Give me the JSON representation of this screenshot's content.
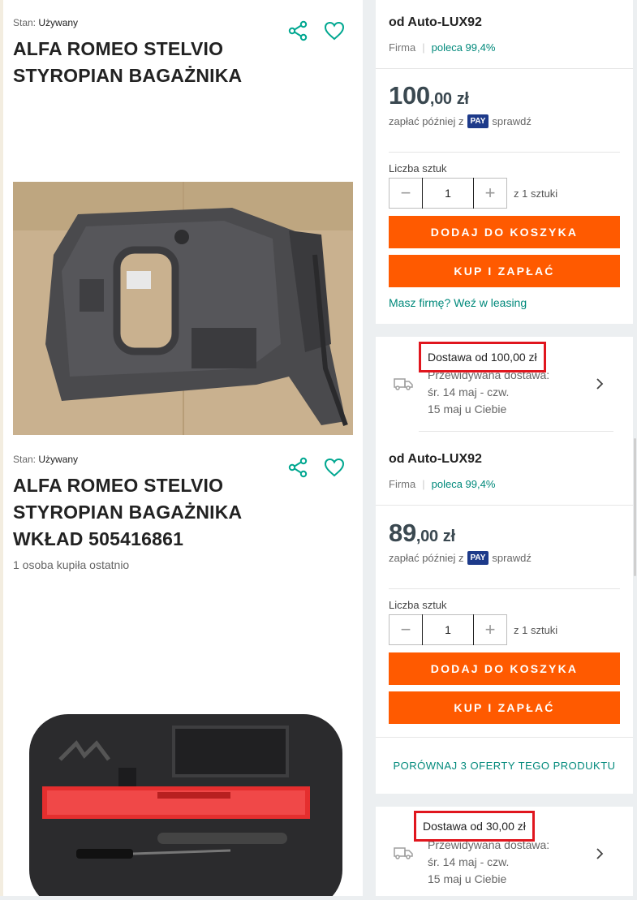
{
  "offers": [
    {
      "condition_label": "Stan:",
      "condition_value": "Używany",
      "title_lines": [
        "ALFA ROMEO STELVIO",
        "STYROPIAN BAGAŻNIKA"
      ],
      "image_alt": "Szara wkładka styropianowa bagażnika",
      "seller": {
        "name": "od Auto-LUX92",
        "type": "Firma",
        "recommend": "poleca 99,4%"
      },
      "price": {
        "whole": "100",
        "decimal": ",00",
        "currency": "zł"
      },
      "pay_later": {
        "prefix": "zapłać później z",
        "badge": "PAY",
        "suffix": "sprawdź"
      },
      "quantity": {
        "label": "Liczba sztuk",
        "value": "1",
        "of": "z 1 sztuki"
      },
      "add_to_cart": "DODAJ DO KOSZYKA",
      "buy_now": "KUP I ZAPŁAĆ",
      "leasing_link": "Masz firmę? Weź w leasing",
      "delivery": {
        "from": "Dostawa od 100,00 zł",
        "lines": [
          "Przewidywana dostawa:",
          "śr. 14 maj - czw.",
          "15 maj u Ciebie"
        ]
      }
    },
    {
      "condition_label": "Stan:",
      "condition_value": "Używany",
      "title_lines": [
        "ALFA ROMEO STELVIO",
        "STYROPIAN BAGAŻNIKA",
        "WKŁAD 505416861"
      ],
      "sold_info": "1 osoba kupiła ostatnio",
      "image_alt": "Czarna wkładka piankowa z trójkątem ostrzegawczym",
      "seller": {
        "name": "od Auto-LUX92",
        "type": "Firma",
        "recommend": "poleca 99,4%"
      },
      "price": {
        "whole": "89",
        "decimal": ",00",
        "currency": "zł"
      },
      "pay_later": {
        "prefix": "zapłać później z",
        "badge": "PAY",
        "suffix": "sprawdź"
      },
      "quantity": {
        "label": "Liczba sztuk",
        "value": "1",
        "of": "z 1 sztuki"
      },
      "add_to_cart": "DODAJ DO KOSZYKA",
      "buy_now": "KUP I ZAPŁAĆ",
      "compare_link": "PORÓWNAJ 3 OFERTY TEGO PRODUKTU",
      "delivery": {
        "from": "Dostawa od 30,00 zł",
        "lines": [
          "Przewidywana dostawa:",
          "śr. 14 maj - czw.",
          "15 maj u Ciebie"
        ]
      }
    }
  ],
  "icons": [
    "share-icon",
    "heart-icon",
    "minus-icon",
    "plus-icon",
    "truck-icon",
    "chevron-right-icon"
  ],
  "colors": {
    "accent": "#ff5a00",
    "link": "#00897b",
    "highlight": "#e0161e",
    "pay_badge": "#1d3a8a"
  }
}
